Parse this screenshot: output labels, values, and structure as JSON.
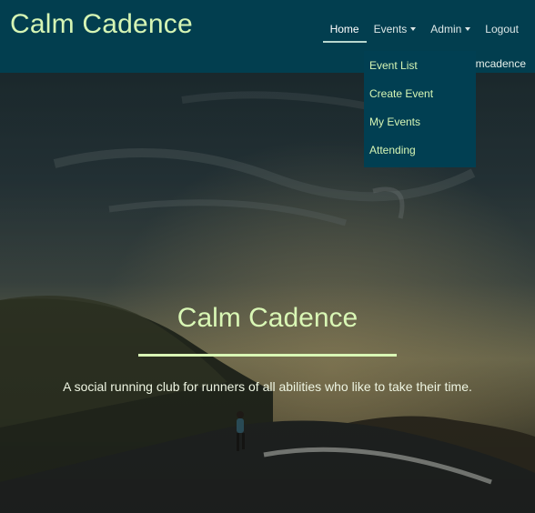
{
  "navbar": {
    "brand": "Calm Cadence",
    "items": [
      {
        "label": "Home",
        "active": true,
        "has_caret": false
      },
      {
        "label": "Events",
        "active": false,
        "has_caret": true
      },
      {
        "label": "Admin",
        "active": false,
        "has_caret": true
      },
      {
        "label": "Logout",
        "active": false,
        "has_caret": false
      }
    ],
    "welcome_text": "mcadence"
  },
  "events_dropdown": {
    "open": true,
    "items": [
      "Event List",
      "Create Event",
      "My Events",
      "Attending"
    ]
  },
  "hero": {
    "title": "Calm Cadence",
    "subtitle": "A social running club for runners of all abilities who like to take their time."
  },
  "colors": {
    "navbar_bg": "#023e4f",
    "accent_green": "#d6f5b4",
    "dropdown_bg": "#013f52"
  }
}
